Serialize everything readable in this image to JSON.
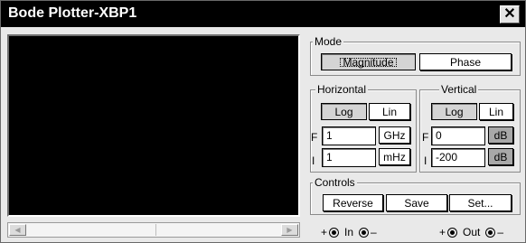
{
  "window": {
    "title": "Bode Plotter-XBP1",
    "close_label": "✕"
  },
  "mode": {
    "legend": "Mode",
    "magnitude_label": "Magnitude",
    "phase_label": "Phase",
    "selected": "Magnitude"
  },
  "horizontal": {
    "legend": "Horizontal",
    "log_label": "Log",
    "lin_label": "Lin",
    "selected": "Log",
    "final": {
      "label": "F",
      "value": "1",
      "unit": "GHz"
    },
    "initial": {
      "label": "I",
      "value": "1",
      "unit": "mHz"
    }
  },
  "vertical": {
    "legend": "Vertical",
    "log_label": "Log",
    "lin_label": "Lin",
    "selected": "Log",
    "final": {
      "label": "F",
      "value": "0",
      "unit": "dB"
    },
    "initial": {
      "label": "I",
      "value": "-200",
      "unit": "dB"
    }
  },
  "controls": {
    "legend": "Controls",
    "reverse_label": "Reverse",
    "save_label": "Save",
    "set_label": "Set..."
  },
  "terminals": {
    "in": {
      "plus": "+",
      "label": "In",
      "minus": "–"
    },
    "out": {
      "plus": "+",
      "label": "Out",
      "minus": "–"
    }
  },
  "colors": {
    "titlebar": "#000000",
    "plot_background": "#000000",
    "unit_selected": "#a8a8a8"
  }
}
